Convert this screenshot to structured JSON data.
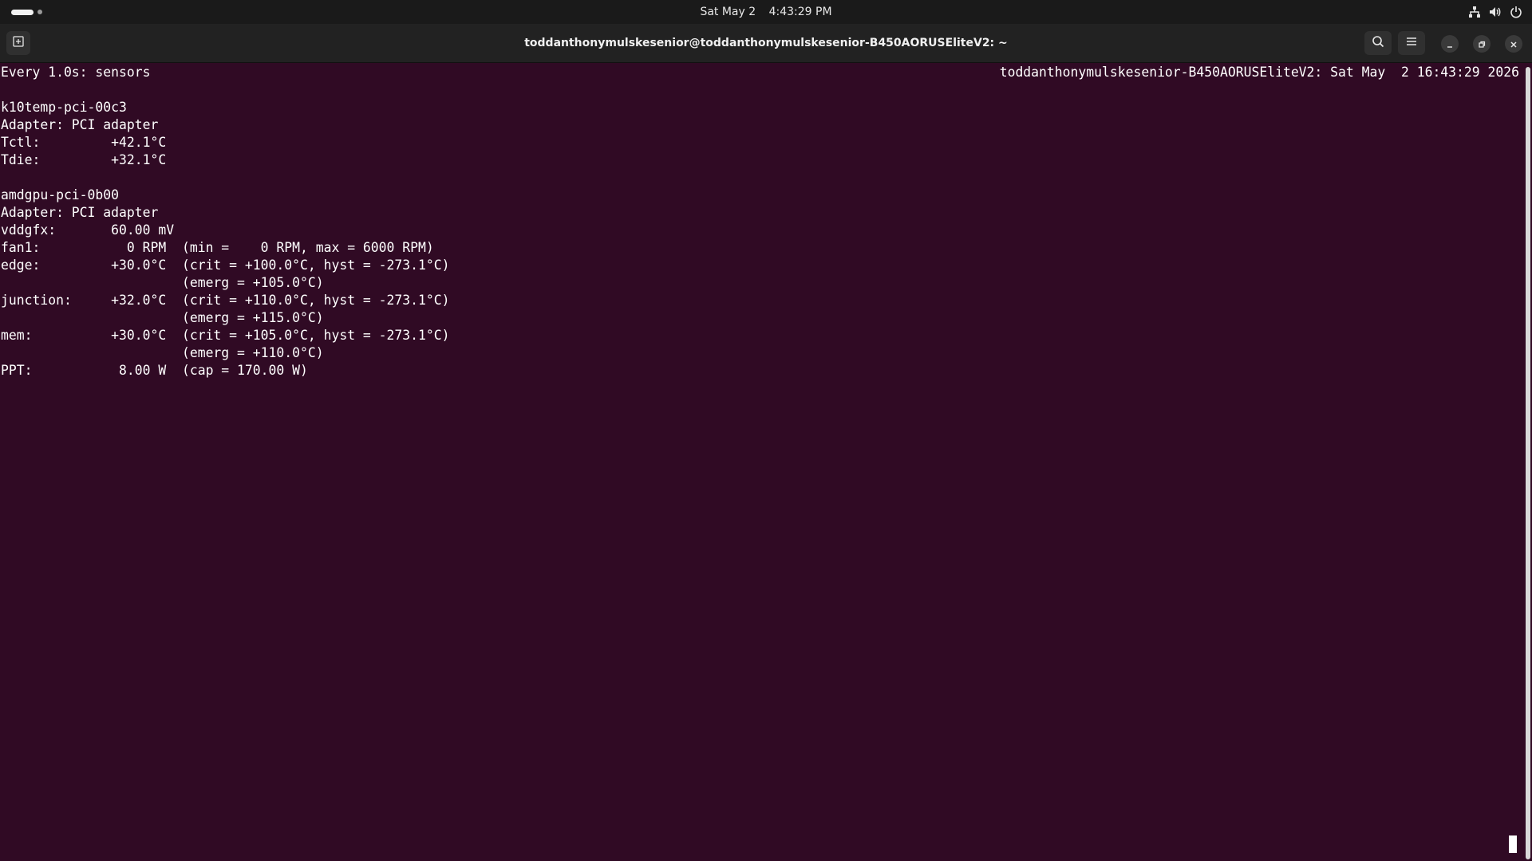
{
  "topbar": {
    "date": "Sat May 2",
    "time": "4:43:29 PM",
    "tray_icons": [
      "network-icon",
      "volume-icon",
      "power-icon"
    ]
  },
  "window": {
    "title": "toddanthonymulskesenior@toddanthonymulskesenior-B450AORUSEliteV2: ~",
    "buttons": [
      "new-tab-icon",
      "search-icon",
      "menu-icon",
      "minimize-icon",
      "restore-icon",
      "close-icon"
    ]
  },
  "terminal": {
    "header_left": "Every 1.0s: sensors",
    "header_right": "toddanthonymulskesenior-B450AORUSEliteV2: Sat May  2 16:43:29 2026",
    "lines": [
      "",
      "k10temp-pci-00c3",
      "Adapter: PCI adapter",
      "Tctl:         +42.1°C",
      "Tdie:         +32.1°C",
      "",
      "amdgpu-pci-0b00",
      "Adapter: PCI adapter",
      "vddgfx:       60.00 mV",
      "fan1:           0 RPM  (min =    0 RPM, max = 6000 RPM)",
      "edge:         +30.0°C  (crit = +100.0°C, hyst = -273.1°C)",
      "                       (emerg = +105.0°C)",
      "junction:     +32.0°C  (crit = +110.0°C, hyst = -273.1°C)",
      "                       (emerg = +115.0°C)",
      "mem:          +30.0°C  (crit = +105.0°C, hyst = -273.1°C)",
      "                       (emerg = +110.0°C)",
      "PPT:           8.00 W  (cap = 170.00 W)"
    ]
  },
  "colors": {
    "terminal_bg": "#300a24",
    "headerbar_bg": "#222222",
    "topbar_bg": "#1a1a1a",
    "text": "#ffffff"
  }
}
